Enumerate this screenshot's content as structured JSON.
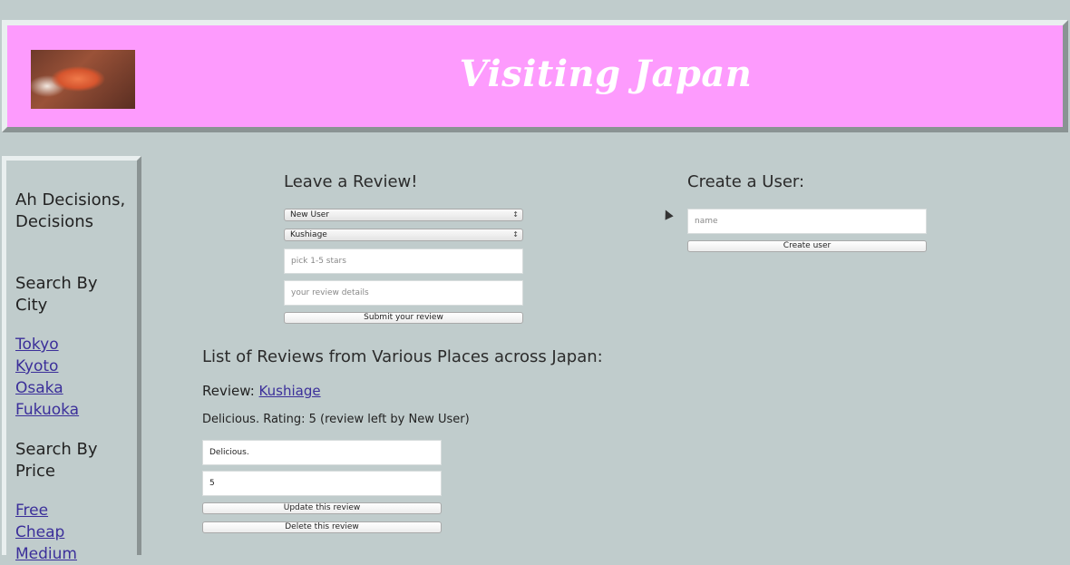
{
  "header": {
    "title": "Visiting Japan",
    "logo_icon": "sushi-photo"
  },
  "sidebar": {
    "heading": "Ah Decisions, Decisions",
    "city_heading": "Search By City",
    "cities": [
      "Tokyo",
      "Kyoto",
      "Osaka",
      "Fukuoka"
    ],
    "price_heading": "Search By Price",
    "prices": [
      "Free",
      "Cheap",
      "Medium"
    ]
  },
  "review_form": {
    "title": "Leave a Review!",
    "user_select": "New User",
    "place_select": "Kushiage",
    "stars_placeholder": "pick 1-5 stars",
    "details_placeholder": "your review details",
    "submit_label": "Submit your review"
  },
  "user_form": {
    "title": "Create a User:",
    "name_placeholder": "name",
    "create_label": "Create user"
  },
  "reviews": {
    "title": "List of Reviews from Various Places across Japan:",
    "items": [
      {
        "prefix": "Review:",
        "place": "Kushiage",
        "summary": "Delicious. Rating: 5 (review left by New User)",
        "details_value": "Delicious.",
        "rating_value": "5",
        "update_label": "Update this review",
        "delete_label": "Delete this review"
      }
    ]
  }
}
